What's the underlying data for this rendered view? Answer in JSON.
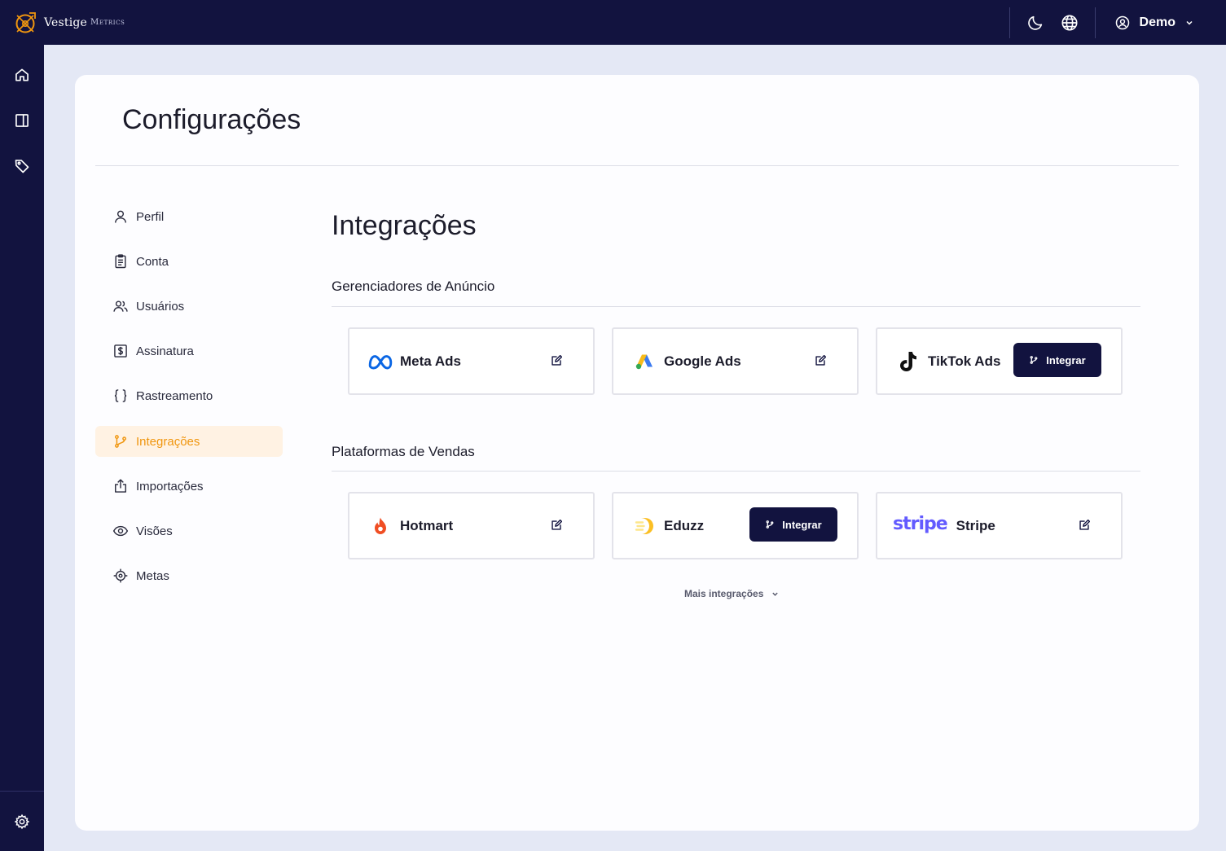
{
  "app": {
    "brand_name": "Vestige",
    "brand_sub": "Metrics"
  },
  "topbar": {
    "user_name": "Demo"
  },
  "page": {
    "title": "Configurações"
  },
  "nav": {
    "items": [
      {
        "label": "Perfil",
        "icon": "user-icon"
      },
      {
        "label": "Conta",
        "icon": "clipboard-icon"
      },
      {
        "label": "Usuários",
        "icon": "users-icon"
      },
      {
        "label": "Assinatura",
        "icon": "dollar-icon"
      },
      {
        "label": "Rastreamento",
        "icon": "braces-icon"
      },
      {
        "label": "Integrações",
        "icon": "git-branch-icon",
        "active": true
      },
      {
        "label": "Importações",
        "icon": "upload-icon"
      },
      {
        "label": "Visões",
        "icon": "eye-icon"
      },
      {
        "label": "Metas",
        "icon": "target-icon"
      }
    ]
  },
  "integrations": {
    "title": "Integrações",
    "ads_group": {
      "label": "Gerenciadores de Anúncio",
      "cards": [
        {
          "name": "Meta Ads",
          "logo": "meta-logo",
          "action": "edit"
        },
        {
          "name": "Google Ads",
          "logo": "google-ads-logo",
          "action": "edit"
        },
        {
          "name": "TikTok Ads",
          "logo": "tiktok-logo",
          "action": "integrate",
          "button_label": "Integrar"
        }
      ]
    },
    "sales_group": {
      "label": "Plataformas de Vendas",
      "cards": [
        {
          "name": "Hotmart",
          "logo": "hotmart-logo",
          "action": "edit"
        },
        {
          "name": "Eduzz",
          "logo": "eduzz-logo",
          "action": "integrate",
          "button_label": "Integrar"
        },
        {
          "name": "Stripe",
          "logo": "stripe-logo",
          "logo_text": "stripe",
          "action": "edit"
        }
      ]
    },
    "more_label": "Mais integrações"
  },
  "colors": {
    "navy": "#12133f",
    "accent_orange": "#f0960f",
    "active_bg": "#fff2e3",
    "stripe_purple": "#635bff"
  }
}
